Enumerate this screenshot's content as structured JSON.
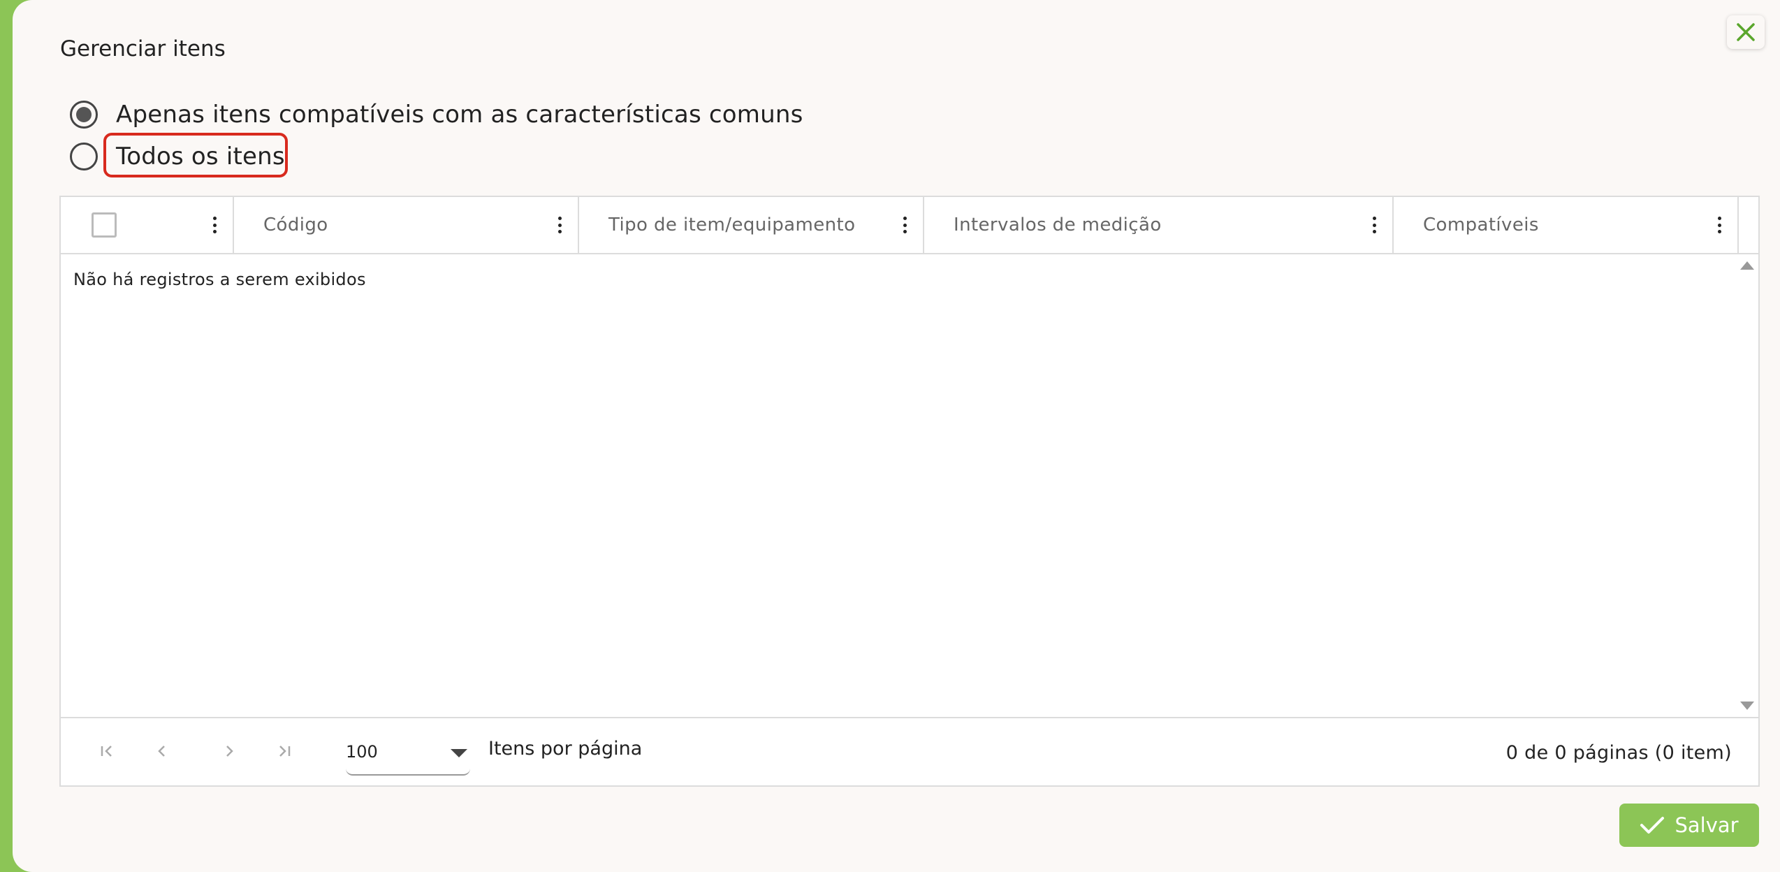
{
  "dialog": {
    "title": "Gerenciar itens",
    "close_icon": "close-icon"
  },
  "filter": {
    "options": [
      {
        "label": "Apenas itens compatíveis com as características comuns",
        "selected": true
      },
      {
        "label": "Todos os itens",
        "selected": false
      }
    ]
  },
  "grid": {
    "columns": [
      {
        "label": ""
      },
      {
        "label": "Código"
      },
      {
        "label": "Tipo de item/equipamento"
      },
      {
        "label": "Intervalos de medição"
      },
      {
        "label": "Compatíveis"
      }
    ],
    "empty_message": "Não há registros a serem exibidos",
    "rows": []
  },
  "pager": {
    "page_size": "100",
    "per_page_label": "Itens por página",
    "page_info": "0 de 0 páginas (0 item)"
  },
  "footer": {
    "save_label": "Salvar"
  },
  "colors": {
    "accent": "#8cc556",
    "highlight": "#d82a1e",
    "background": "#fbf8f6"
  }
}
